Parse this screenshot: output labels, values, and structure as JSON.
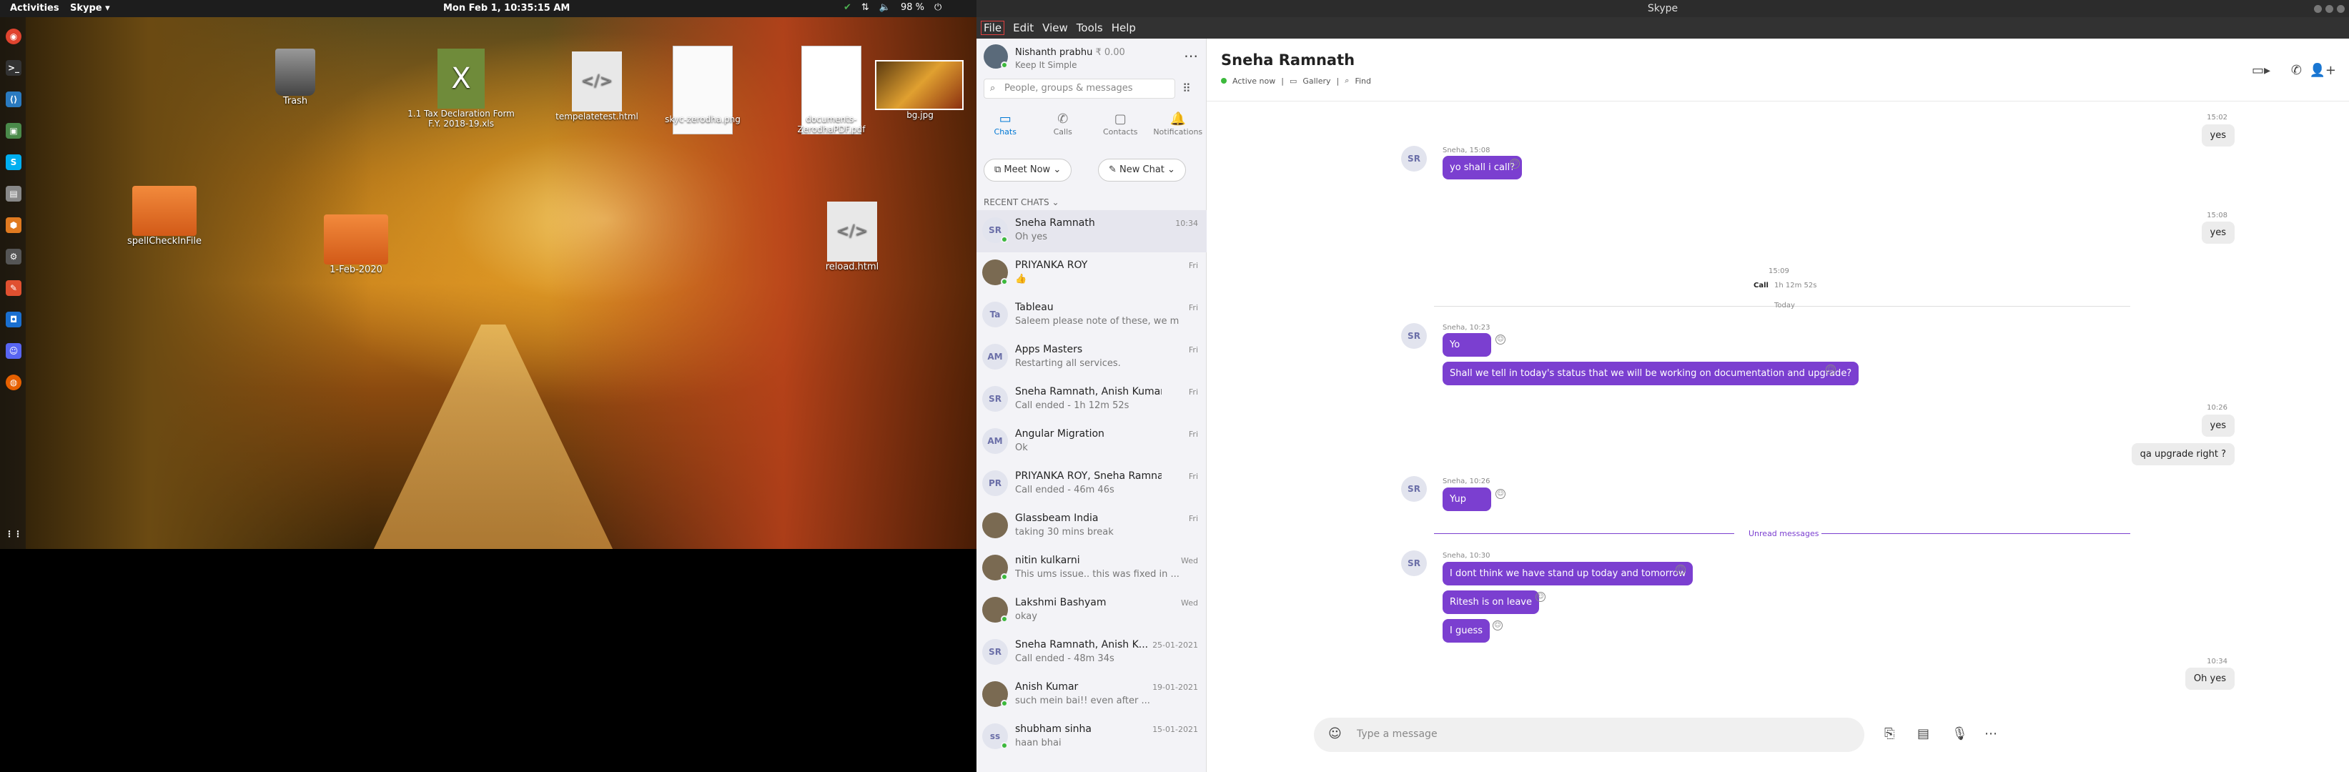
{
  "topbar": {
    "activities": "Activities",
    "app": "Skype ▾",
    "clock": "Mon Feb  1, 10:35:15 AM",
    "battery": "98 %"
  },
  "desktop_icons": [
    {
      "label": "Trash"
    },
    {
      "label": "1.1 Tax Declaration Form F.Y. 2018-19.xls"
    },
    {
      "label": "tempelatetest.html"
    },
    {
      "label": "skyc-zerodha.png"
    },
    {
      "label": "documents-ZerodhaPDF.pdf"
    },
    {
      "label": "bg.jpg"
    },
    {
      "label": "spellCheckInFile"
    },
    {
      "label": "1-Feb-2020"
    },
    {
      "label": "reload.html"
    }
  ],
  "skype": {
    "window_title": "Skype",
    "menu": [
      "File",
      "Edit",
      "View",
      "Tools",
      "Help"
    ],
    "profile": {
      "name": "Nishanth prabhu",
      "balance": "₹ 0.00",
      "mood": "Keep It Simple"
    },
    "search_placeholder": "People, groups & messages",
    "nav": [
      {
        "label": "Chats",
        "icon": "chat-icon"
      },
      {
        "label": "Calls",
        "icon": "phone-icon"
      },
      {
        "label": "Contacts",
        "icon": "contacts-icon"
      },
      {
        "label": "Notifications",
        "icon": "bell-icon"
      }
    ],
    "meet_now": "Meet Now",
    "new_chat": "New Chat",
    "recent_chats_label": "RECENT CHATS",
    "chats": [
      {
        "initials": "SR",
        "name": "Sneha  Ramnath",
        "msg": "Oh yes",
        "time": "10:34",
        "online": true
      },
      {
        "initials": "",
        "name": "PRIYANKA ROY",
        "msg": "👍",
        "time": "Fri",
        "online": true
      },
      {
        "initials": "Ta",
        "name": "Tableau",
        "msg": "Saleem please note of these, we m...",
        "time": "Fri",
        "online": false
      },
      {
        "initials": "AM",
        "name": "Apps Masters",
        "msg": "Restarting all services.",
        "time": "Fri",
        "online": false
      },
      {
        "initials": "SR",
        "name": "Sneha  Ramnath, Anish Kumar",
        "msg": "Call ended - 1h 12m 52s",
        "time": "Fri",
        "online": false
      },
      {
        "initials": "AM",
        "name": "Angular Migration",
        "msg": "Ok",
        "time": "Fri",
        "online": false
      },
      {
        "initials": "PR",
        "name": "PRIYANKA ROY, Sneha  Ramnath",
        "msg": "Call ended - 46m 46s",
        "time": "Fri",
        "online": false
      },
      {
        "initials": "",
        "name": "Glassbeam India",
        "msg": "taking 30 mins break",
        "time": "Fri",
        "online": false
      },
      {
        "initials": "",
        "name": "nitin kulkarni",
        "msg": "This ums issue.. this was fixed in ...",
        "time": "Wed",
        "online": true
      },
      {
        "initials": "",
        "name": "Lakshmi Bashyam",
        "msg": "okay",
        "time": "Wed",
        "online": true
      },
      {
        "initials": "SR",
        "name": "Sneha  Ramnath, Anish K...",
        "msg": "Call ended - 48m 34s",
        "time": "25-01-2021",
        "online": false
      },
      {
        "initials": "",
        "name": "Anish Kumar",
        "msg": "such mein bai!! even after ...",
        "time": "19-01-2021",
        "online": true
      },
      {
        "initials": "ss",
        "name": "shubham sinha",
        "msg": "haan bhai",
        "time": "15-01-2021",
        "online": true
      }
    ],
    "conversation": {
      "name": "Sneha  Ramnath",
      "status": "Active now",
      "gallery": "Gallery",
      "find": "Find",
      "m1_time": "15:02",
      "m1_text": "yes",
      "m2_meta": "Sneha, 15:08",
      "m2_text": "yo shall i call?",
      "m3_time": "15:08",
      "m3_text": "yes",
      "call_time": "15:09",
      "call_label": "Call",
      "call_duration": "1h 12m 52s",
      "today": "Today",
      "m4_meta": "Sneha, 10:23",
      "m4_text": "Yo",
      "m5_text": "Shall we tell in today's status that we will be working on documentation and upgrade?",
      "m6_time": "10:26",
      "m6_text": "yes",
      "m7_text": "qa upgrade right ?",
      "m8_meta": "Sneha, 10:26",
      "m8_text": "Yup",
      "unread": "Unread messages",
      "m9_meta": "Sneha, 10:30",
      "m9_text": "I dont think we have stand up today and tomorrow",
      "m10_text": "Ritesh is on leave",
      "m11_text": "I guess",
      "m12_time": "10:34",
      "m12_text": "Oh yes",
      "composer_placeholder": "Type a message",
      "avatar_initials": "SR"
    }
  }
}
